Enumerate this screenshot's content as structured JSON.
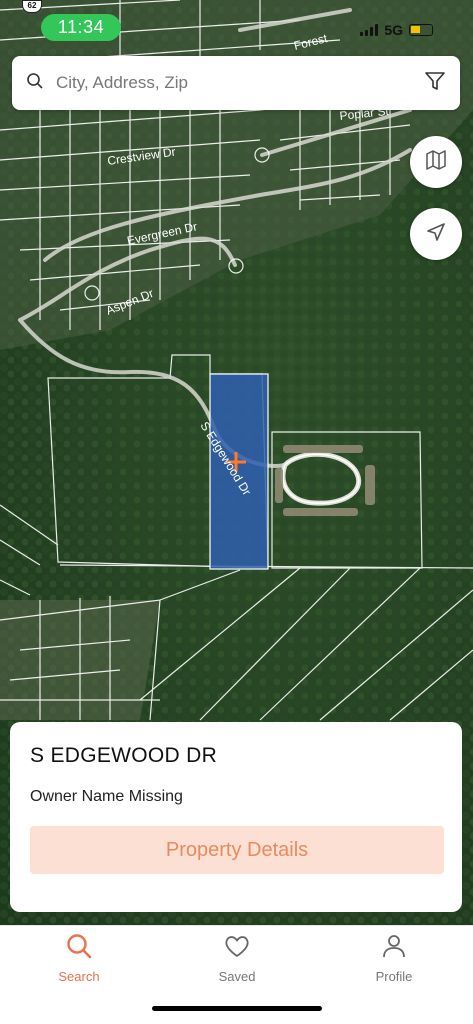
{
  "status_bar": {
    "time": "11:34",
    "route_badge": "62",
    "network": "5G"
  },
  "map": {
    "street_labels": {
      "forest": "Forest",
      "poplar": "Poplar St",
      "crestview": "Crestview Dr",
      "evergreen": "Evergreen Dr",
      "aspen": "Aspen Dr",
      "edgewood": "S Edgewood Dr"
    },
    "parcel_color": "#2f5fb0"
  },
  "search": {
    "placeholder": "City, Address, Zip",
    "icon": "search-icon",
    "filter_icon": "filter-icon"
  },
  "map_buttons": {
    "layers_icon": "map-icon",
    "locate_icon": "location-arrow-icon"
  },
  "property_card": {
    "title": "S EDGEWOOD DR",
    "owner": "Owner Name Missing",
    "details_button": "Property Details"
  },
  "tabs": [
    {
      "label": "Search",
      "icon": "search-icon",
      "active": true
    },
    {
      "label": "Saved",
      "icon": "heart-icon",
      "active": false
    },
    {
      "label": "Profile",
      "icon": "person-icon",
      "active": false
    }
  ],
  "colors": {
    "accent": "#e8724d",
    "button_bg": "#fde0d4",
    "status_green": "#33c759"
  }
}
